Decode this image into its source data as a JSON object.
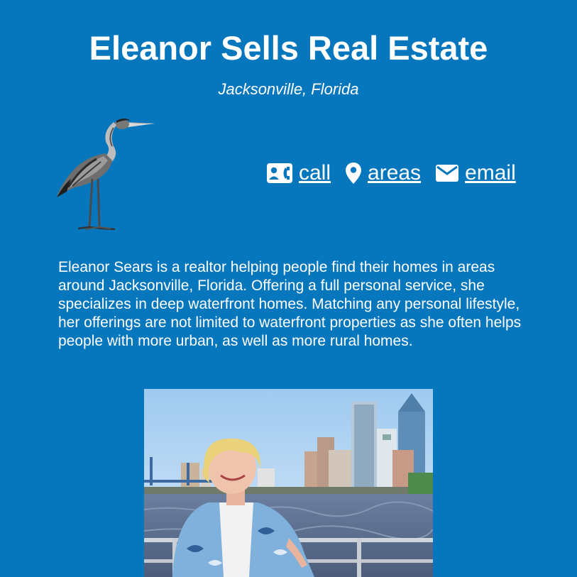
{
  "header": {
    "title": "Eleanor Sells Real Estate",
    "subtitle": "Jacksonville, Florida"
  },
  "nav": {
    "call": {
      "label": "call",
      "icon": "contact-phone-icon"
    },
    "areas": {
      "label": "areas",
      "icon": "map-pin-icon"
    },
    "email": {
      "label": "email",
      "icon": "envelope-icon"
    }
  },
  "bio": {
    "text": "Eleanor Sears is a realtor helping people find their homes in areas around Jacksonville, Florida. Offering a full personal service, she specializes in deep waterfront homes. Matching any personal lifestyle, her offerings are not limited to waterfront properties as she often helps people with more urban, as well as more rural homes."
  },
  "images": {
    "logo": "heron-illustration",
    "photo": "portrait-with-jacksonville-skyline"
  },
  "colors": {
    "background": "#0677bd",
    "text": "#ffffff"
  }
}
